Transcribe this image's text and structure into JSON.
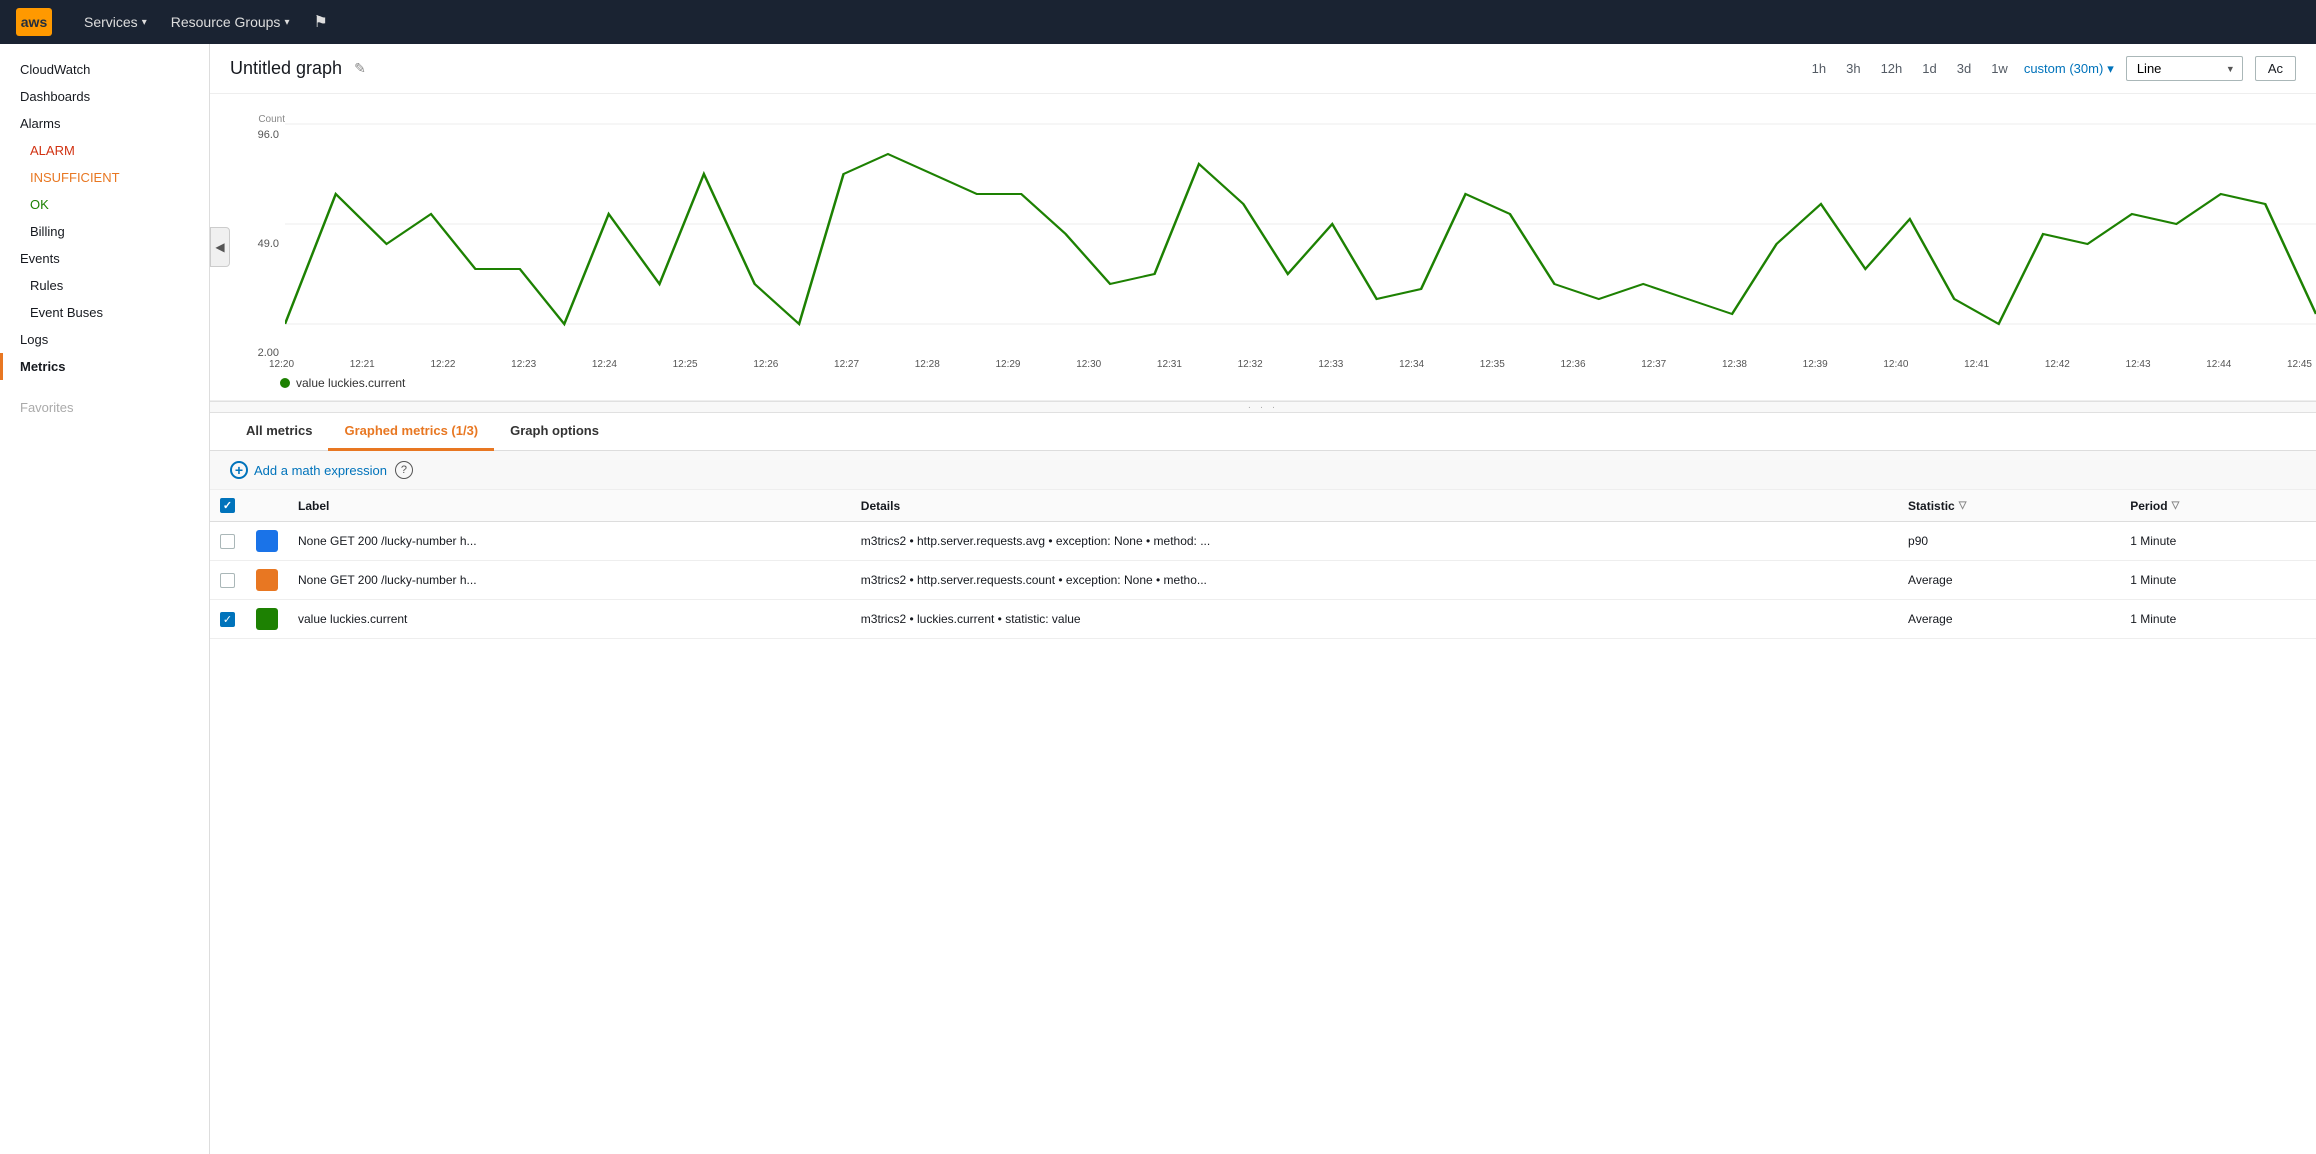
{
  "topNav": {
    "logo": "aws",
    "services_label": "Services",
    "resource_groups_label": "Resource Groups",
    "bookmarks_icon": "★"
  },
  "sidebar": {
    "items": [
      {
        "id": "cloudwatch",
        "label": "CloudWatch",
        "type": "main"
      },
      {
        "id": "dashboards",
        "label": "Dashboards",
        "type": "main"
      },
      {
        "id": "alarms",
        "label": "Alarms",
        "type": "main"
      },
      {
        "id": "alarm",
        "label": "ALARM",
        "type": "alarm-red"
      },
      {
        "id": "insufficient",
        "label": "INSUFFICIENT",
        "type": "alarm-orange"
      },
      {
        "id": "ok",
        "label": "OK",
        "type": "alarm-green"
      },
      {
        "id": "billing",
        "label": "Billing",
        "type": "child"
      },
      {
        "id": "events",
        "label": "Events",
        "type": "main"
      },
      {
        "id": "rules",
        "label": "Rules",
        "type": "child"
      },
      {
        "id": "event-buses",
        "label": "Event Buses",
        "type": "child"
      },
      {
        "id": "logs",
        "label": "Logs",
        "type": "main"
      },
      {
        "id": "metrics",
        "label": "Metrics",
        "type": "main active"
      }
    ],
    "favorites_label": "Favorites"
  },
  "graph": {
    "title": "Untitled graph",
    "edit_icon": "✎",
    "time_options": [
      "1h",
      "3h",
      "12h",
      "1d",
      "3d",
      "1w"
    ],
    "active_time": "custom (30m)",
    "chart_type": "Line",
    "action_btn": "Ac",
    "y_axis_label": "Count",
    "y_values": [
      "96.0",
      "49.0",
      "2.00"
    ],
    "x_labels": [
      "12:20",
      "12:21",
      "12:22",
      "12:23",
      "12:24",
      "12:25",
      "12:26",
      "12:27",
      "12:28",
      "12:29",
      "12:30",
      "12:31",
      "12:32",
      "12:33",
      "12:34",
      "12:35",
      "12:36",
      "12:37",
      "12:38",
      "12:39",
      "12:40",
      "12:41",
      "12:42",
      "12:43",
      "12:44",
      "12:45"
    ],
    "legend_color": "#1d8102",
    "legend_label": "value luckies.current",
    "line_color": "#1d8102"
  },
  "tabs": [
    {
      "id": "all-metrics",
      "label": "All metrics",
      "active": false
    },
    {
      "id": "graphed-metrics",
      "label": "Graphed metrics (1/3)",
      "active": true
    },
    {
      "id": "graph-options",
      "label": "Graph options",
      "active": false
    }
  ],
  "addExpression": {
    "label": "Add a math expression"
  },
  "table": {
    "columns": [
      "",
      "",
      "Label",
      "Details",
      "Statistic",
      "Period"
    ],
    "rows": [
      {
        "checked": false,
        "color": "#1a73e8",
        "label": "None GET 200 /lucky-number h...",
        "details": "m3trics2 • http.server.requests.avg • exception: None • method: ...",
        "statistic": "p90",
        "period": "1 Minute"
      },
      {
        "checked": false,
        "color": "#e87722",
        "label": "None GET 200 /lucky-number h...",
        "details": "m3trics2 • http.server.requests.count • exception: None • metho...",
        "statistic": "Average",
        "period": "1 Minute"
      },
      {
        "checked": true,
        "color": "#1d8102",
        "label": "value luckies.current",
        "details": "m3trics2 • luckies.current • statistic: value",
        "statistic": "Average",
        "period": "1 Minute"
      }
    ]
  }
}
